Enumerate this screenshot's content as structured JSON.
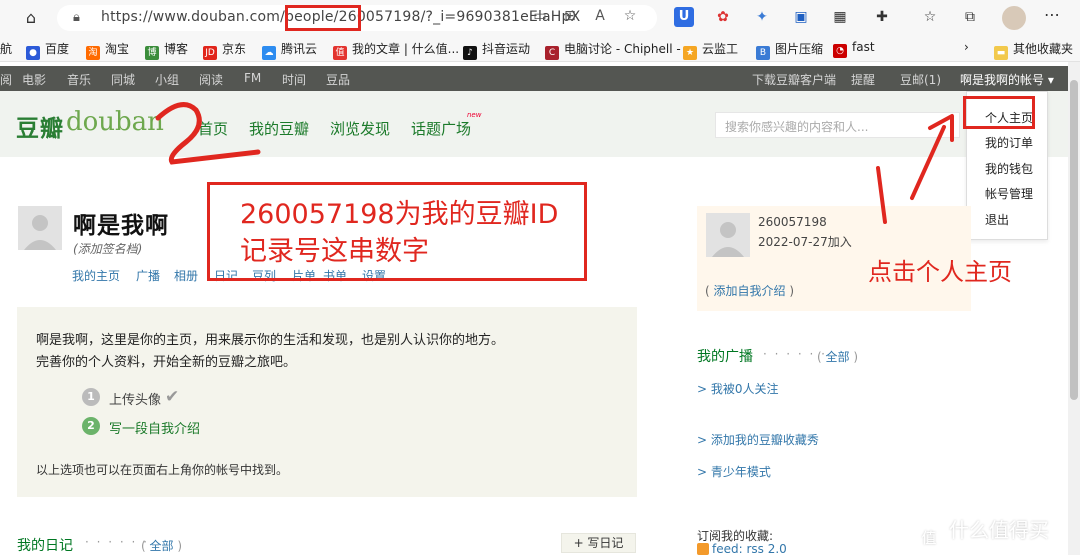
{
  "browser": {
    "url": "https://www.douban.com/people/260057198/?_i=9690381eElaHpX",
    "extensions": [
      "U",
      "✿",
      "✦",
      "▣",
      "▦",
      "✚",
      "☆",
      "⧉"
    ],
    "bookmarks": [
      "航",
      "百度",
      "淘宝",
      "博客",
      "京东",
      "腾讯云",
      "我的文章 | 什么值...",
      "抖音运动",
      "电脑讨论 - Chiphell -",
      "云监工",
      "图片压缩",
      "fast",
      "其他收藏夹"
    ]
  },
  "topnav": {
    "items": [
      "电影",
      "音乐",
      "同城",
      "小组",
      "阅读",
      "FM",
      "时间",
      "豆品"
    ],
    "download": "下载豆瓣客户端",
    "remind": "提醒",
    "mail": "豆邮(1)",
    "account": "啊是我啊的帐号 ▾"
  },
  "header": {
    "logo_cn": "豆瓣",
    "logo_en": "douban",
    "nav": [
      "首页",
      "我的豆瓣",
      "浏览发现",
      "话题广场"
    ],
    "new_tag": "new",
    "search_placeholder": "搜索你感兴趣的内容和人..."
  },
  "dropdown": {
    "items": [
      "个人主页",
      "我的订单",
      "我的钱包",
      "帐号管理",
      "退出"
    ]
  },
  "annotations": {
    "number": "2",
    "id_note_line1": "260057198为我的豆瓣ID",
    "id_note_line2": "记录号这串数字",
    "click_note": "点击个人主页"
  },
  "profile": {
    "name": "啊是我啊",
    "signature": "(添加签名档)",
    "links": [
      "我的主页",
      "广播",
      "相册",
      "日记",
      "豆列",
      "片单",
      "书单",
      "设置"
    ]
  },
  "intro": {
    "line1": "啊是我啊，这里是你的主页，用来展示你的生活和发现，也是别人认识你的地方。",
    "line2": "完善你的个人资料，开始全新的豆瓣之旅吧。",
    "step1_num": "1",
    "step1": "上传头像",
    "step2_num": "2",
    "step2": "写一段自我介绍",
    "footer": "以上选项也可以在页面右上角你的帐号中找到。"
  },
  "diary": {
    "title": "我的日记",
    "dots": "· · · · · ·",
    "all_open": "(",
    "all": "全部",
    "all_close": ")",
    "write": "+ 写日记"
  },
  "side": {
    "id": "260057198",
    "joined": "2022-07-27加入",
    "intro_open": "(",
    "add_intro": "添加自我介绍",
    "intro_close": ")",
    "broadcast_title": "我的广播",
    "broadcast_dots": "· · · · · ·",
    "all_open": "(",
    "all": "全部",
    "all_close": ")",
    "followed": "> 我被0人关注",
    "collection": "> 添加我的豆瓣收藏秀",
    "youth": "> 青少年模式",
    "subscribe": "订阅我的收藏:",
    "rss": "feed: rss 2.0"
  },
  "watermark": {
    "badge": "值",
    "text": "什么值得买"
  }
}
